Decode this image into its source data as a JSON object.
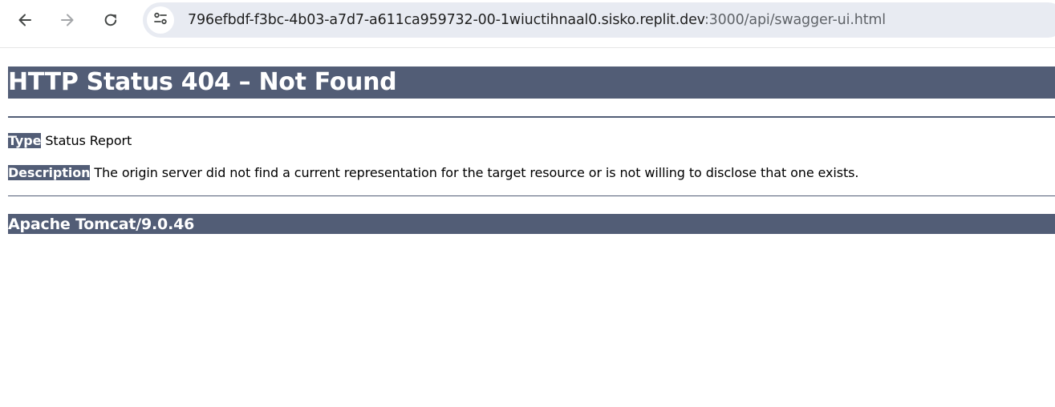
{
  "browser": {
    "back_icon": "arrow-left-icon",
    "forward_icon": "arrow-right-icon",
    "reload_icon": "reload-icon",
    "site_info_icon": "tune-icon",
    "url_host": "796efbdf-f3bc-4b03-a7d7-a611ca959732-00-1wiuctihnaal0.sisko.replit.dev",
    "url_rest": ":3000/api/swagger-ui.html"
  },
  "page": {
    "title": "HTTP Status 404 – Not Found",
    "type_label": "Type",
    "type_value": "Status Report",
    "description_label": "Description",
    "description_value": "The origin server did not find a current representation for the target resource or is not willing to disclose that one exists.",
    "server_info": "Apache Tomcat/9.0.46"
  },
  "colors": {
    "header_bg": "#525d76",
    "header_text": "#ffffff",
    "omnibox_bg": "#e8ebf2"
  }
}
